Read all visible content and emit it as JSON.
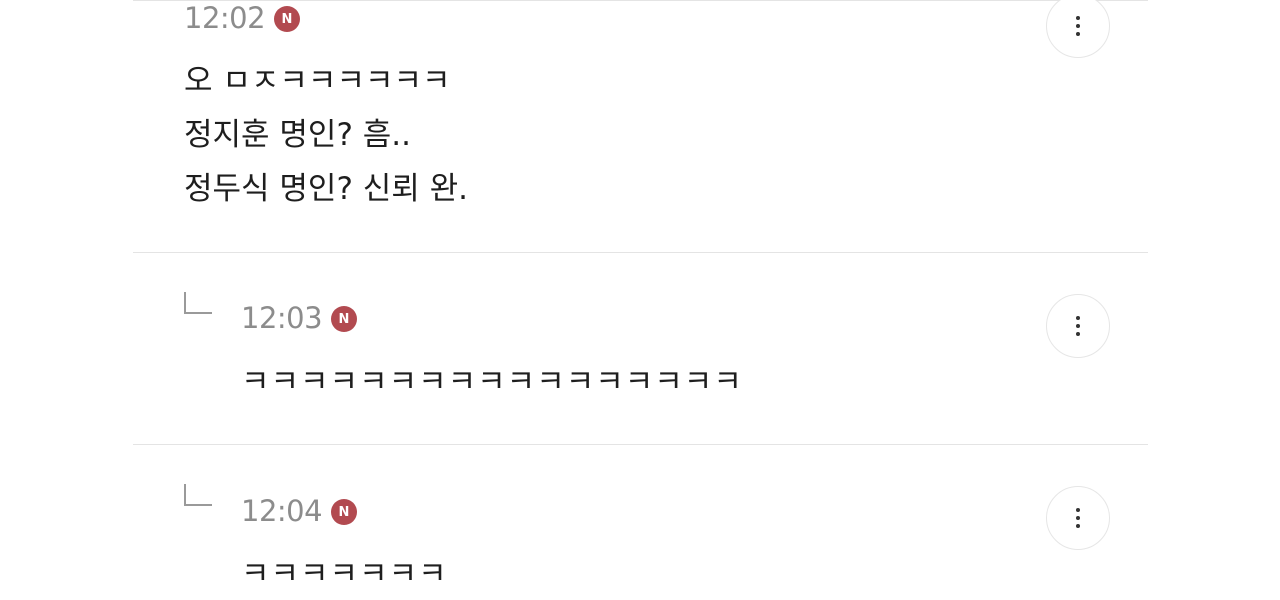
{
  "comments": [
    {
      "time": "12:02",
      "badge": "N",
      "lines": [
        "오 ㅁㅈㅋㅋㅋㅋㅋㅋ",
        "정지훈 명인? 흠..",
        "정두식 명인? 신뢰 완."
      ],
      "is_reply": false
    },
    {
      "time": "12:03",
      "badge": "N",
      "lines": [
        "ㅋㅋㅋㅋㅋㅋㅋㅋㅋㅋㅋㅋㅋㅋㅋㅋㅋ"
      ],
      "is_reply": true
    },
    {
      "time": "12:04",
      "badge": "N",
      "lines": [
        "ㅋㅋㅋㅋㅋㅋㅋ"
      ],
      "is_reply": true
    }
  ],
  "icons": {
    "more": "more-vertical-icon",
    "reply": "reply-arrow-icon",
    "new": "new-badge-icon"
  },
  "colors": {
    "badge": "#b24a50",
    "timestamp": "#8c8c8c",
    "text": "#1e1e1e",
    "divider": "#e4e4e4"
  }
}
